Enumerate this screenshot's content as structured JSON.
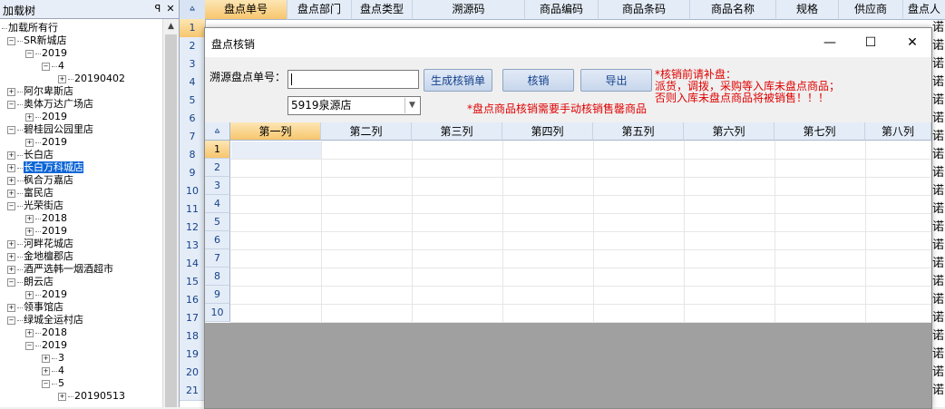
{
  "tree": {
    "title": "加载树",
    "pin_icon": "pin-icon",
    "close_icon": "close-icon",
    "items": [
      {
        "label": "加载所有行"
      },
      {
        "label": "SR新城店"
      },
      {
        "label": "2019"
      },
      {
        "label": "4"
      },
      {
        "label": "20190402"
      },
      {
        "label": "阿尔卑斯店"
      },
      {
        "label": "奥体万达广场店"
      },
      {
        "label": "2019"
      },
      {
        "label": "碧桂园公园里店"
      },
      {
        "label": "2019"
      },
      {
        "label": "长白店"
      },
      {
        "label": "长白万科城店"
      },
      {
        "label": "枫合万嘉店"
      },
      {
        "label": "富民店"
      },
      {
        "label": "光荣街店"
      },
      {
        "label": "2018"
      },
      {
        "label": "2019"
      },
      {
        "label": "河畔花城店"
      },
      {
        "label": "金地檀郡店"
      },
      {
        "label": "酒严选韩一烟酒超市"
      },
      {
        "label": "朗云店"
      },
      {
        "label": "2019"
      },
      {
        "label": "领事馆店"
      },
      {
        "label": "绿城全运村店"
      },
      {
        "label": "2018"
      },
      {
        "label": "2019"
      },
      {
        "label": "3"
      },
      {
        "label": "4"
      },
      {
        "label": "5"
      },
      {
        "label": "20190513"
      }
    ]
  },
  "bg_grid": {
    "columns": [
      "盘点单号",
      "盘点部门",
      "盘点类型",
      "溯源码",
      "商品编码",
      "商品条码",
      "商品名称",
      "规格",
      "供应商",
      "盘点人"
    ],
    "row_numbers": [
      "1",
      "2",
      "3",
      "4",
      "5",
      "6",
      "7",
      "8",
      "9",
      "10",
      "11",
      "12",
      "13",
      "14",
      "15",
      "16",
      "17",
      "18",
      "19",
      "20",
      "21"
    ],
    "right_col_char": "诺"
  },
  "dialog": {
    "title": "盘点核销",
    "minimize_icon": "minimize-icon",
    "maximize_icon": "maximize-icon",
    "close_icon": "close-icon",
    "source_label": "溯源盘点单号：",
    "source_value": "",
    "generate_button": "生成核销单",
    "verify_button": "核销",
    "export_button": "导出",
    "store_value": "5919泉源店",
    "warn_small": "*盘点商品核销需要手动核销售罄商品",
    "warn_right": [
      "*核销前请补盘：",
      "派货，调拨，采购等入库未盘点商品；",
      "否则入库未盘点商品将被销售！！！"
    ],
    "grid": {
      "columns": [
        "第一列",
        "第二列",
        "第三列",
        "第四列",
        "第五列",
        "第六列",
        "第七列",
        "第八列"
      ],
      "rows": [
        "1",
        "2",
        "3",
        "4",
        "5",
        "6",
        "7",
        "8",
        "9",
        "10"
      ]
    }
  },
  "colors": {
    "accent": "#15428b",
    "warning": "#e00000",
    "selection": "#0a64d6",
    "active_header": "#f7c66e"
  }
}
